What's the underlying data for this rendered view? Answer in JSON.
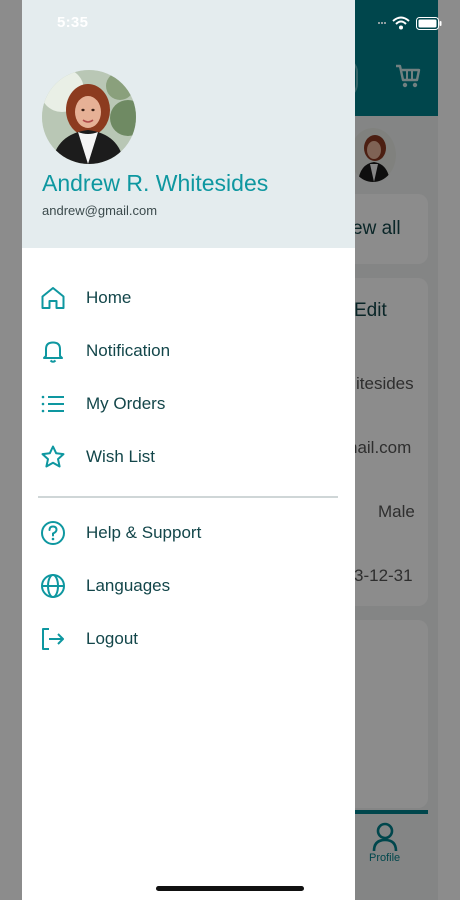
{
  "status_bar": {
    "time": "5:35"
  },
  "user": {
    "name": "Andrew R. Whitesides",
    "email": "andrew@gmail.com",
    "avatar_icon": "user-photo"
  },
  "menu": {
    "primary": [
      {
        "label": "Home",
        "icon": "home-icon"
      },
      {
        "label": "Notification",
        "icon": "bell-icon"
      },
      {
        "label": "My Orders",
        "icon": "list-icon"
      },
      {
        "label": "Wish List",
        "icon": "star-icon"
      }
    ],
    "secondary": [
      {
        "label": "Help & Support",
        "icon": "help-icon"
      },
      {
        "label": "Languages",
        "icon": "globe-icon"
      },
      {
        "label": "Logout",
        "icon": "logout-icon"
      }
    ]
  },
  "background": {
    "view_all": "ew all",
    "edit": "Edit",
    "name_fragment": "itesides",
    "email_fragment": "nail.com",
    "gender": "Male",
    "date_fragment": "3-12-31",
    "tab_profile": "Profile"
  },
  "colors": {
    "accent": "#00808a",
    "name_text": "#0e97a0",
    "header_bg": "#e4ecee"
  }
}
